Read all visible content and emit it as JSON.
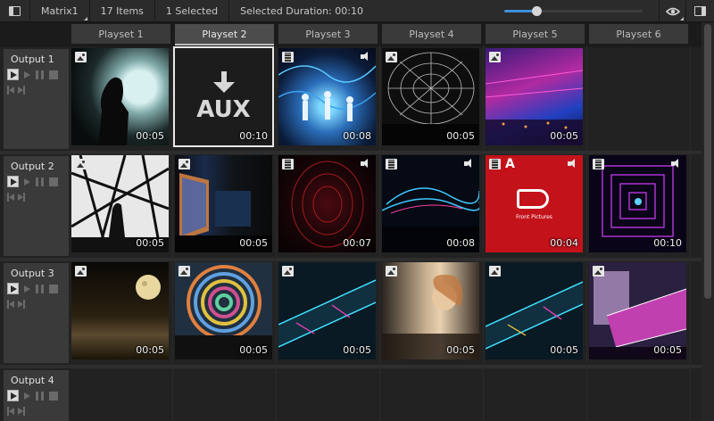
{
  "toolbar": {
    "matrix_name": "Matrix1",
    "items_count": "17 Items",
    "selected_count": "1 Selected",
    "selected_duration": "Selected Duration: 00:10",
    "zoom_slider_value": 0.23
  },
  "playsets": [
    {
      "label": "Playset 1"
    },
    {
      "label": "Playset 2"
    },
    {
      "label": "Playset 3"
    },
    {
      "label": "Playset 4"
    },
    {
      "label": "Playset 5"
    },
    {
      "label": "Playset 6"
    }
  ],
  "outputs": [
    {
      "label": "Output 1"
    },
    {
      "label": "Output 2"
    },
    {
      "label": "Output 3"
    },
    {
      "label": "Output 4"
    }
  ],
  "tiles": {
    "r1c1": {
      "duration": "00:05",
      "type": "image-icon"
    },
    "r1c2": {
      "duration": "00:10",
      "label": "AUX"
    },
    "r1c3": {
      "duration": "00:08",
      "type": "film-icon",
      "sound": true
    },
    "r1c4": {
      "duration": "00:05",
      "type": "image-icon"
    },
    "r1c5": {
      "duration": "00:05",
      "type": "image-icon"
    },
    "r2c1": {
      "duration": "00:05",
      "type": "image-icon"
    },
    "r2c2": {
      "duration": "00:05",
      "type": "image-icon"
    },
    "r2c3": {
      "duration": "00:07",
      "type": "film-icon",
      "sound": true
    },
    "r2c4": {
      "duration": "00:08",
      "type": "film-icon",
      "sound": true
    },
    "r2c5": {
      "duration": "00:04",
      "type": "film-icon",
      "sound": true,
      "badge": "A",
      "logo_text": "Front Pictures"
    },
    "r2c6": {
      "duration": "00:10",
      "type": "film-icon",
      "sound": true
    },
    "r3c1": {
      "duration": "00:05",
      "type": "image-icon"
    },
    "r3c2": {
      "duration": "00:05",
      "type": "image-icon"
    },
    "r3c3": {
      "duration": "00:05",
      "type": "image-icon"
    },
    "r3c4": {
      "duration": "00:05",
      "type": "image-icon"
    },
    "r3c5": {
      "duration": "00:05",
      "type": "image-icon"
    },
    "r3c6": {
      "duration": "00:05",
      "type": "image-icon"
    }
  },
  "colors": {
    "accent": "#3d8fd8",
    "background": "#1e1e1e",
    "header": "#3a3a3a",
    "aux_red": "#c4121b"
  }
}
